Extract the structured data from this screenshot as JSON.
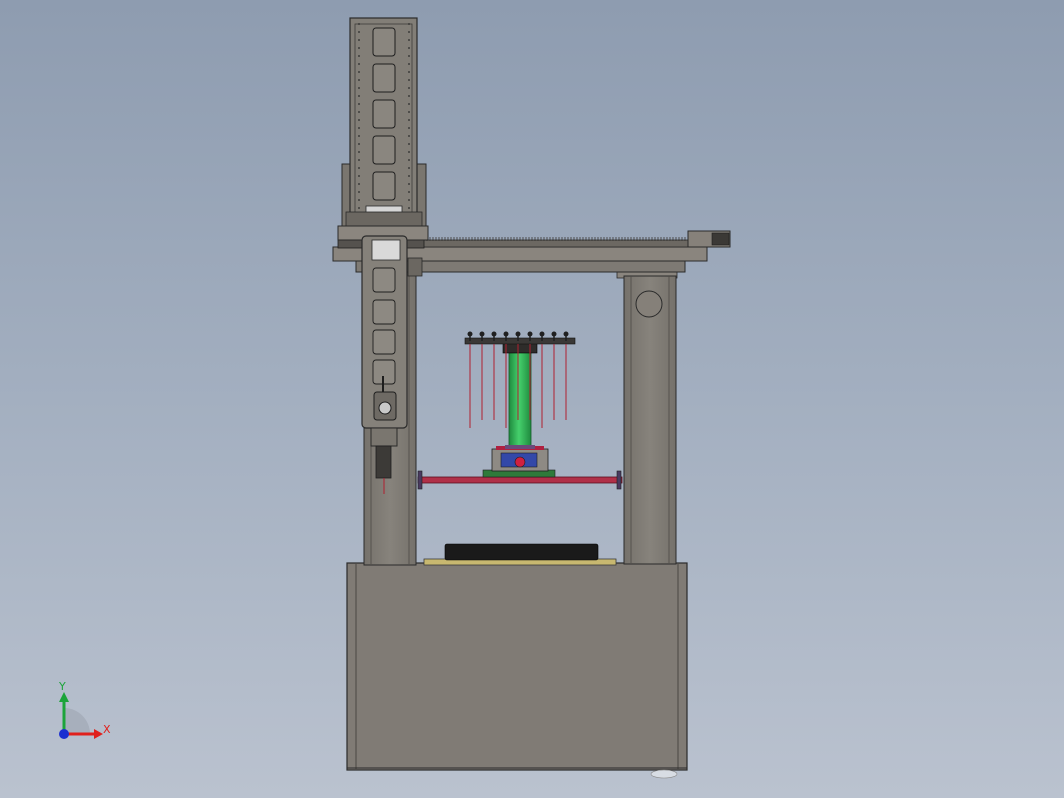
{
  "viewport": {
    "background_top": "#8e9cb0",
    "background_bottom": "#bac2cf"
  },
  "model_colors": {
    "frame": "#7e7a74",
    "frame_dark": "#3a3a3a",
    "column_tube": "#2fbf5a",
    "wire": "#b02030",
    "crossbar": "#b03048",
    "tray_top": "#1a1a1a",
    "tray_base": "#c8b870"
  },
  "triad": {
    "x_label": "X",
    "y_label": "Y",
    "x_color": "#e0201c",
    "y_color": "#1ca43a",
    "z_color": "#1a2fd0"
  }
}
